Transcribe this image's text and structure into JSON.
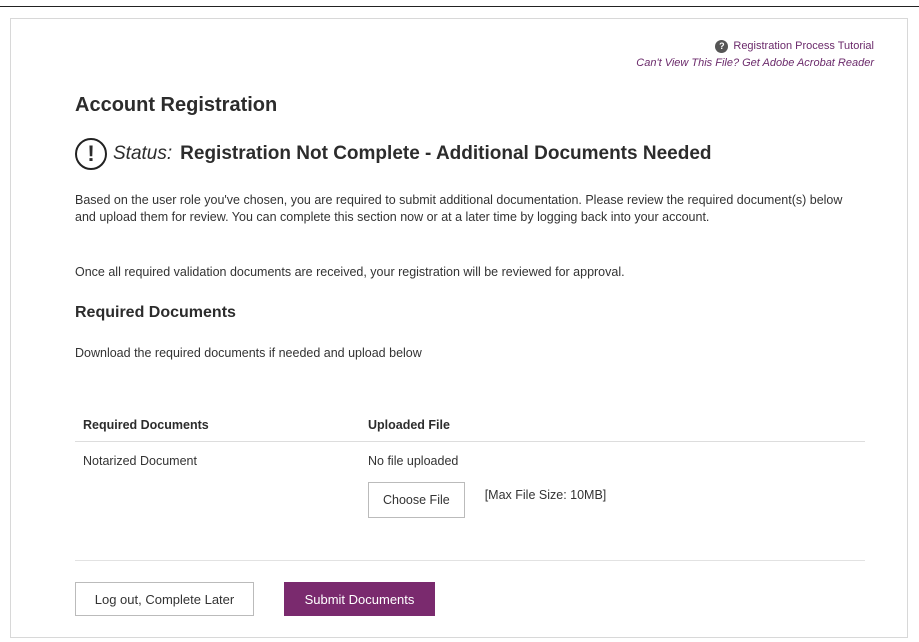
{
  "help": {
    "tutorial_icon": "question-icon",
    "tutorial_link": "Registration Process Tutorial",
    "acrobat_link": "Can't View This File? Get Adobe Acrobat Reader"
  },
  "page": {
    "title": "Account Registration"
  },
  "status": {
    "icon": "exclamation-circle-icon",
    "label": "Status:",
    "value": "Registration Not Complete - Additional Documents Needed"
  },
  "intro": {
    "paragraph1": "Based on the user role you've chosen, you are required to submit additional documentation. Please review the required document(s) below and upload them for review. You can complete this section now or at a later time by logging back into your account.",
    "paragraph2": "Once all required validation documents are received, your registration will be reviewed for approval."
  },
  "required_docs": {
    "heading": "Required Documents",
    "instructions": "Download the required documents if needed and upload below",
    "columns": [
      "Required Documents",
      "Uploaded File"
    ],
    "rows": [
      {
        "document": "Notarized Document",
        "uploaded": "No file uploaded",
        "choose_label": "Choose File",
        "max_size": "[Max File Size: 10MB]"
      }
    ]
  },
  "actions": {
    "logout_label": "Log out, Complete Later",
    "submit_label": "Submit Documents"
  },
  "colors": {
    "accent": "#7a2a6e",
    "link": "#6b2a6b"
  }
}
